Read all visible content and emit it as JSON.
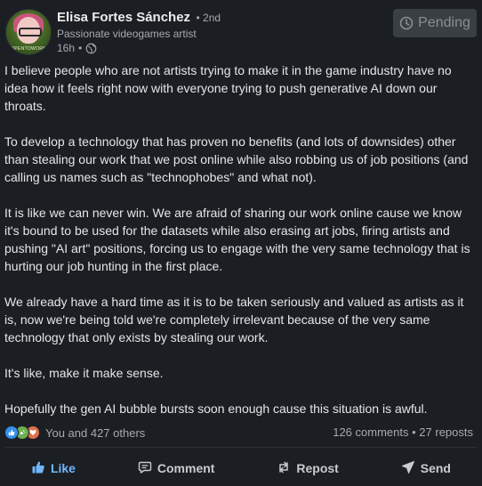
{
  "author": {
    "name": "Elisa Fortes Sánchez",
    "degree": "• 2nd",
    "headline": "Passionate videogames artist",
    "time": "16h",
    "visibility_icon": "globe-icon",
    "avatar_ring_text": "OPENTOWORK"
  },
  "pending_button": {
    "label": "Pending",
    "icon": "clock-icon"
  },
  "post": {
    "paragraphs": [
      "I believe people who are not artists trying to make it in the game industry have no idea how it feels right now with everyone trying to push generative AI down our throats.",
      "To develop a technology that has proven no benefits (and lots of downsides) other than stealing our work that we post online while also robbing us of job positions (and calling us names such as \"technophobes\" and what not).",
      "It is like we can never win. We are afraid of sharing our work online cause we know it's bound to be used for the datasets while also erasing art jobs, firing artists and pushing \"AI art\" positions, forcing us to engage with the very same technology that is hurting our job hunting in the first place.",
      "We already have a hard time as it is to be taken seriously and valued as artists as it is, now we're being told we're completely irrelevant because of the very same technology that only exists by stealing our work.",
      "It's like, make it make sense.",
      "Hopefully the gen AI bubble bursts soon enough cause this situation is awful."
    ]
  },
  "social": {
    "reaction_icons": [
      "like-icon",
      "celebrate-icon",
      "love-icon"
    ],
    "reactions_text": "You and 427 others",
    "comments": "126 comments",
    "separator": "•",
    "reposts": "27 reposts"
  },
  "actions": {
    "like": "Like",
    "comment": "Comment",
    "repost": "Repost",
    "send": "Send"
  },
  "colors": {
    "background": "#1b1f23",
    "accent": "#71b7fb",
    "text": "#e6e6e6",
    "muted": "#a7aaad"
  }
}
